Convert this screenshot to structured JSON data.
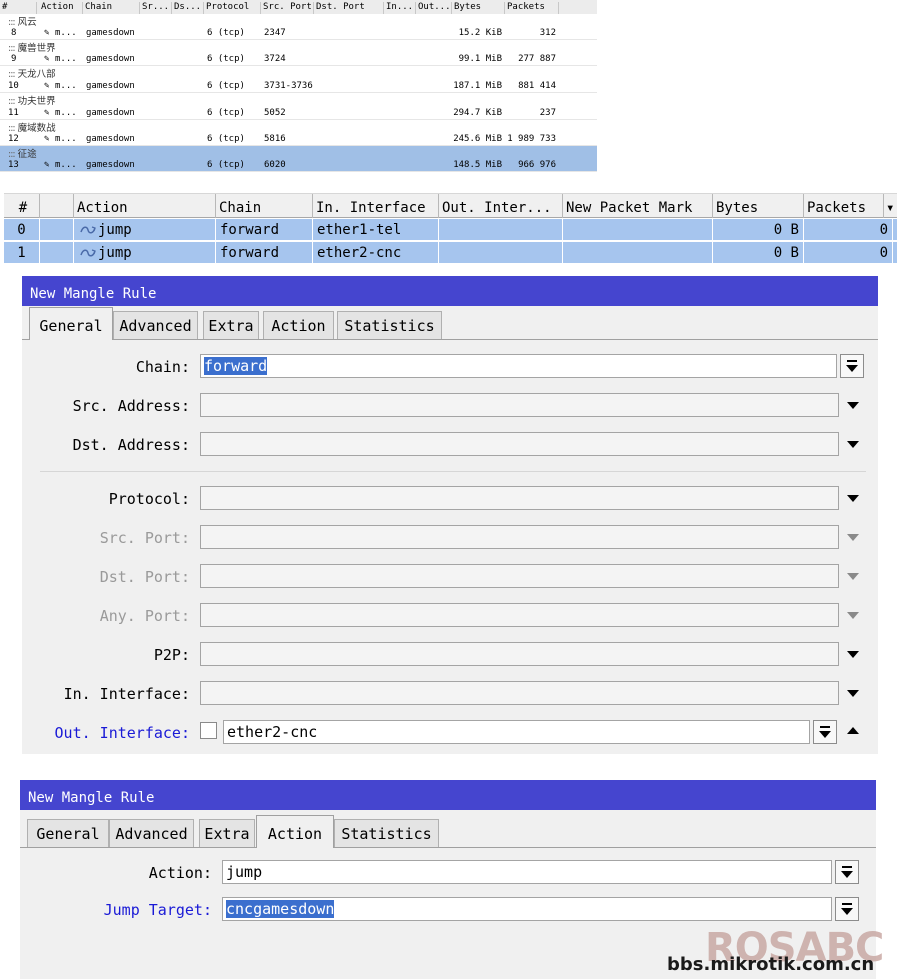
{
  "table1": {
    "columns": [
      "#",
      "Action",
      "Chain",
      "Sr...",
      "Ds...",
      "Protocol",
      "Src. Port",
      "Dst. Port",
      "In...",
      "Out...",
      "Bytes",
      "Packets"
    ],
    "groups": [
      {
        "comment": "风云",
        "row": {
          "num": "8",
          "action": "m...",
          "chain": "gamesdown",
          "protocol": "6 (tcp)",
          "src_port": "2347",
          "bytes": "15.2 KiB",
          "packets": "312"
        }
      },
      {
        "comment": "魔兽世界",
        "row": {
          "num": "9",
          "action": "m...",
          "chain": "gamesdown",
          "protocol": "6 (tcp)",
          "src_port": "3724",
          "bytes": "99.1 MiB",
          "packets": "277 887"
        }
      },
      {
        "comment": "天龙八部",
        "row": {
          "num": "10",
          "action": "m...",
          "chain": "gamesdown",
          "protocol": "6 (tcp)",
          "src_port": "3731-3736",
          "bytes": "187.1 MiB",
          "packets": "881 414"
        }
      },
      {
        "comment": "功夫世界",
        "row": {
          "num": "11",
          "action": "m...",
          "chain": "gamesdown",
          "protocol": "6 (tcp)",
          "src_port": "5052",
          "bytes": "294.7 KiB",
          "packets": "237"
        }
      },
      {
        "comment": "魔域数战",
        "row": {
          "num": "12",
          "action": "m...",
          "chain": "gamesdown",
          "protocol": "6 (tcp)",
          "src_port": "5816",
          "bytes": "245.6 MiB",
          "packets": "1 989 733"
        }
      },
      {
        "comment": "征途",
        "row": {
          "num": "13",
          "action": "m...",
          "chain": "gamesdown",
          "protocol": "6 (tcp)",
          "src_port": "6020",
          "bytes": "148.5 MiB",
          "packets": "966 976"
        }
      }
    ],
    "group_prefix": ":::"
  },
  "table2": {
    "columns": [
      "#",
      "",
      "Action",
      "Chain",
      "In. Interface",
      "Out. Inter...",
      "New Packet Mark",
      "Bytes",
      "Packets"
    ],
    "rows": [
      {
        "num": "0",
        "action": "jump",
        "chain": "forward",
        "in_iface": "ether1-tel",
        "bytes": "0 B",
        "packets": "0"
      },
      {
        "num": "1",
        "action": "jump",
        "chain": "forward",
        "in_iface": "ether2-cnc",
        "bytes": "0 B",
        "packets": "0"
      }
    ]
  },
  "dialog1": {
    "title": "New Mangle Rule",
    "tabs": [
      "General",
      "Advanced",
      "Extra",
      "Action",
      "Statistics"
    ],
    "active_tab": "General",
    "labels": {
      "chain": "Chain:",
      "src_address": "Src. Address:",
      "dst_address": "Dst. Address:",
      "protocol": "Protocol:",
      "src_port": "Src. Port:",
      "dst_port": "Dst. Port:",
      "any_port": "Any. Port:",
      "p2p": "P2P:",
      "in_interface": "In. Interface:",
      "out_interface": "Out. Interface:"
    },
    "values": {
      "chain": "forward",
      "out_interface": "ether2-cnc"
    }
  },
  "dialog2": {
    "title": "New Mangle Rule",
    "tabs": [
      "General",
      "Advanced",
      "Extra",
      "Action",
      "Statistics"
    ],
    "active_tab": "Action",
    "labels": {
      "action": "Action:",
      "jump_target": "Jump Target:"
    },
    "values": {
      "action": "jump",
      "jump_target": "cncgamesdown"
    }
  },
  "watermark": {
    "logo": "ROSABC",
    "site": "bbs.mikrotik.com.cn"
  },
  "colors": {
    "title_bar": "#4545cf",
    "selection": "#a6c5ee",
    "label_blue": "#1a1ad6",
    "text_highlight": "#3b6fce"
  }
}
